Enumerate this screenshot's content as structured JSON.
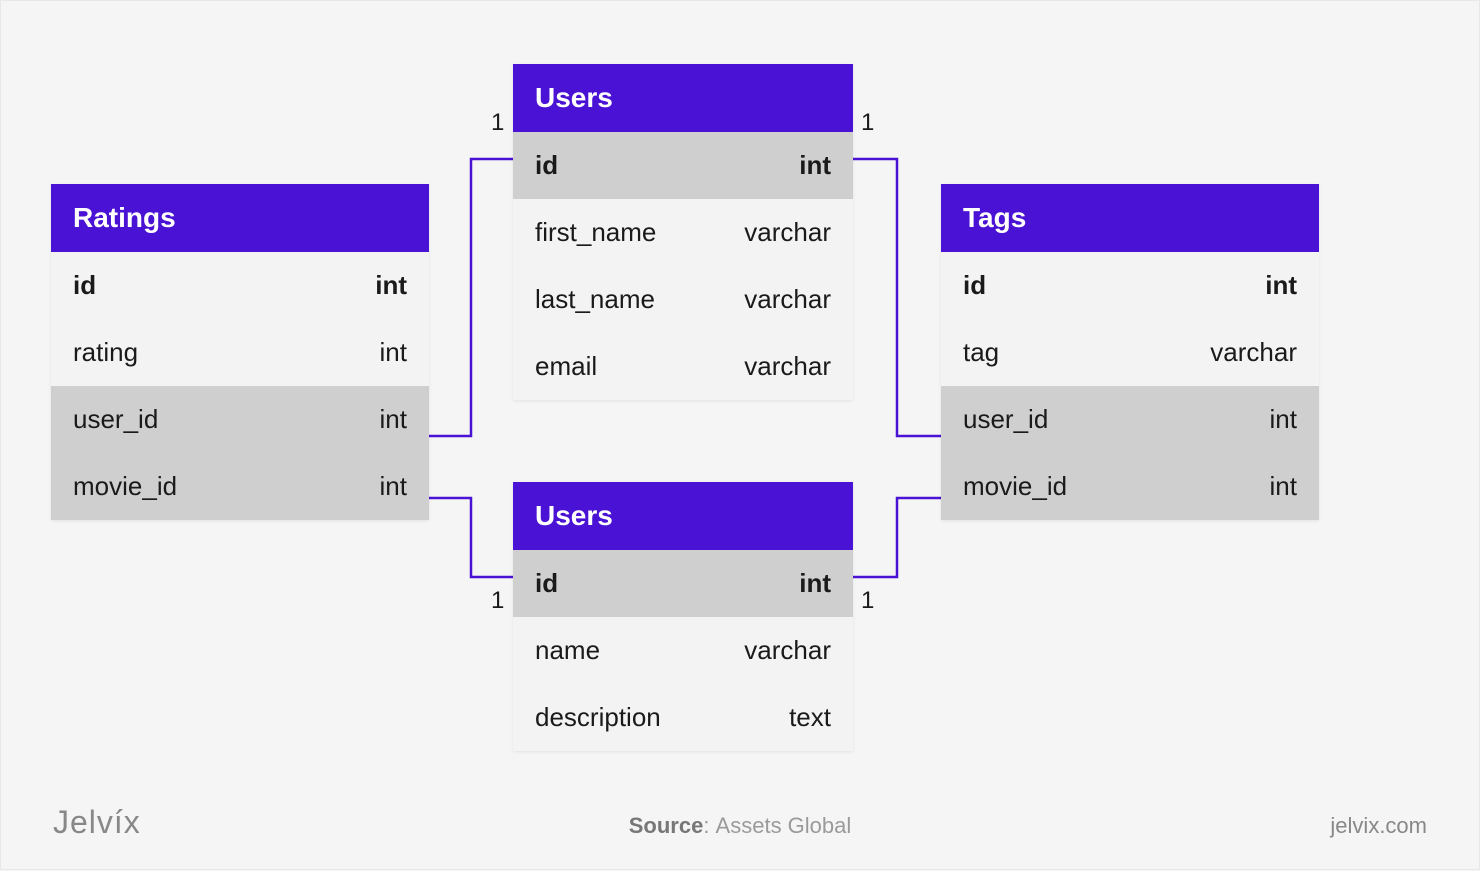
{
  "colors": {
    "accent": "#4a12d4",
    "row_light": "#f3f3f3",
    "row_shaded": "#cfcfcf"
  },
  "tables": {
    "ratings": {
      "title": "Ratings",
      "rows": [
        {
          "name": "id",
          "type": "int",
          "bold": true,
          "shaded": false
        },
        {
          "name": "rating",
          "type": "int",
          "bold": false,
          "shaded": false
        },
        {
          "name": "user_id",
          "type": "int",
          "bold": false,
          "shaded": true
        },
        {
          "name": "movie_id",
          "type": "int",
          "bold": false,
          "shaded": true
        }
      ]
    },
    "users_top": {
      "title": "Users",
      "rows": [
        {
          "name": "id",
          "type": "int",
          "bold": true,
          "shaded": true
        },
        {
          "name": "first_name",
          "type": "varchar",
          "bold": false,
          "shaded": false
        },
        {
          "name": "last_name",
          "type": "varchar",
          "bold": false,
          "shaded": false
        },
        {
          "name": "email",
          "type": "varchar",
          "bold": false,
          "shaded": false
        }
      ]
    },
    "users_bottom": {
      "title": "Users",
      "rows": [
        {
          "name": "id",
          "type": "int",
          "bold": true,
          "shaded": true
        },
        {
          "name": "name",
          "type": "varchar",
          "bold": false,
          "shaded": false
        },
        {
          "name": "description",
          "type": "text",
          "bold": false,
          "shaded": false
        }
      ]
    },
    "tags": {
      "title": "Tags",
      "rows": [
        {
          "name": "id",
          "type": "int",
          "bold": true,
          "shaded": false
        },
        {
          "name": "tag",
          "type": "varchar",
          "bold": false,
          "shaded": false
        },
        {
          "name": "user_id",
          "type": "int",
          "bold": false,
          "shaded": true
        },
        {
          "name": "movie_id",
          "type": "int",
          "bold": false,
          "shaded": true
        }
      ]
    }
  },
  "relationships": [
    {
      "from": "ratings.user_id",
      "to": "users_top.id",
      "to_cardinality": "1"
    },
    {
      "from": "ratings.movie_id",
      "to": "users_bottom.id",
      "to_cardinality": "1"
    },
    {
      "from": "tags.user_id",
      "to": "users_top.id",
      "to_cardinality": "1"
    },
    {
      "from": "tags.movie_id",
      "to": "users_bottom.id",
      "to_cardinality": "1"
    }
  ],
  "cardinality_labels": {
    "top_left": "1",
    "top_right": "1",
    "bottom_left": "1",
    "bottom_right": "1"
  },
  "footer": {
    "logo_text": "Jelvíx",
    "source_label": "Source",
    "source_value": "Assets Global",
    "site": "jelvix.com"
  }
}
